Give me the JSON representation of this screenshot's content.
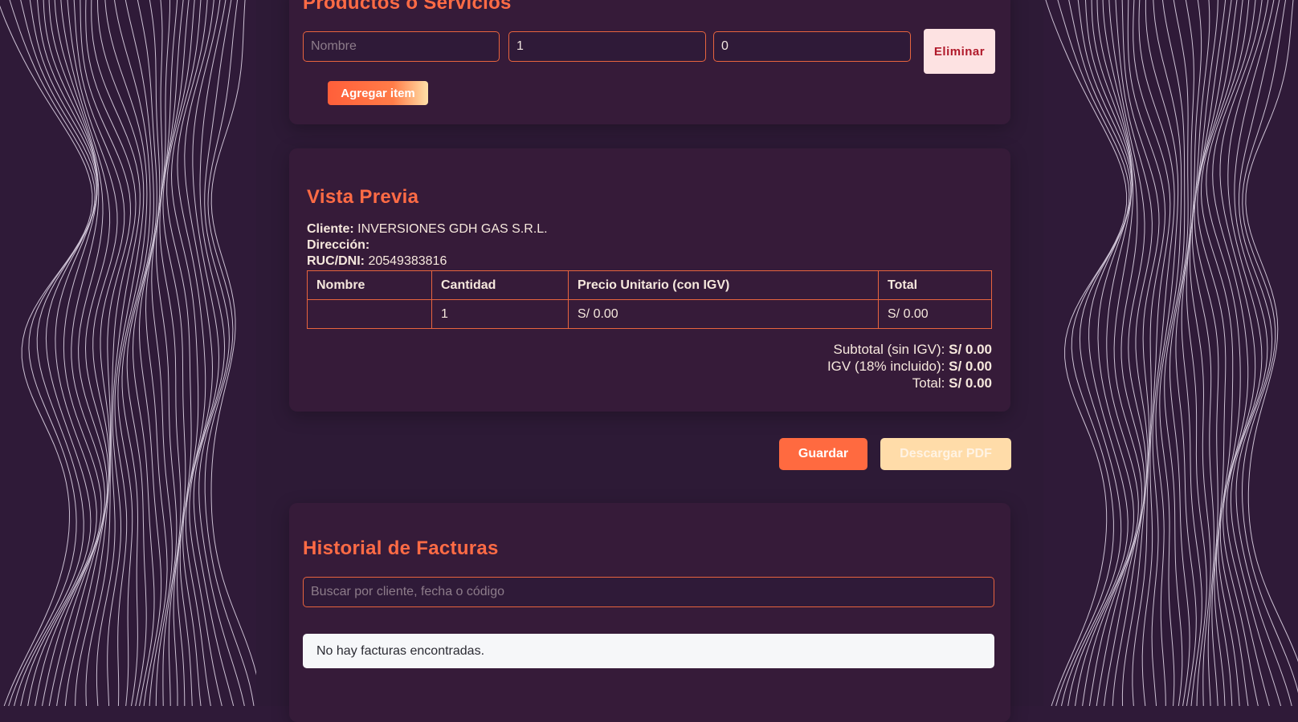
{
  "products": {
    "title": "Productos o Servicios",
    "row": {
      "name_placeholder": "Nombre",
      "name_value": "",
      "quantity_value": "1",
      "price_value": "0",
      "delete_label": "Eliminar"
    },
    "add_item_label": "Agregar item"
  },
  "preview": {
    "title": "Vista Previa",
    "client_label": "Cliente:",
    "client_value": "INVERSIONES GDH GAS S.R.L.",
    "address_label": "Dirección:",
    "address_value": "",
    "ruc_label": "RUC/DNI:",
    "ruc_value": "20549383816",
    "table": {
      "headers": [
        "Nombre",
        "Cantidad",
        "Precio Unitario (con IGV)",
        "Total"
      ],
      "rows": [
        [
          "",
          "1",
          "S/ 0.00",
          "S/ 0.00"
        ]
      ]
    },
    "subtotal_label": "Subtotal (sin IGV):",
    "subtotal_value": "S/ 0.00",
    "igv_label": "IGV (18% incluido):",
    "igv_value": "S/ 0.00",
    "total_label": "Total:",
    "total_value": "S/ 0.00"
  },
  "actions": {
    "save_label": "Guardar",
    "pdf_label": "Descargar PDF"
  },
  "history": {
    "title": "Historial de Facturas",
    "search_placeholder": "Buscar por cliente, fecha o código",
    "search_value": "",
    "empty_message": "No hay facturas encontradas."
  },
  "colors": {
    "accent": "#ff6b45",
    "background": "#2f1a38",
    "card": "#361b39",
    "pdf_button": "#ffdca9",
    "delete_button": "#fde2e2"
  }
}
